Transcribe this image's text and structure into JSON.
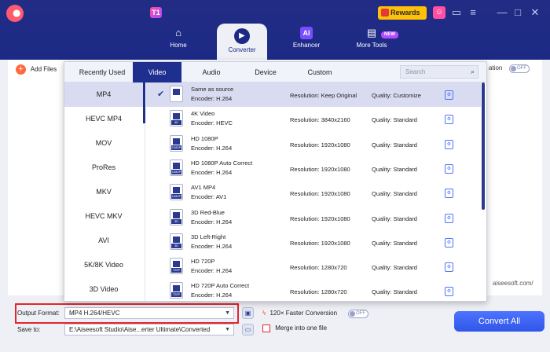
{
  "colors": {
    "topbar": "#1c2a86",
    "accent": "#1f2f8f",
    "highlight": "#d9dcf1",
    "convert_button": "#3f63f3",
    "red_box": "#e3262d",
    "rewards": "#ffc107"
  },
  "header": {
    "badge": "T1",
    "rewards_label": "Rewards",
    "nav": [
      {
        "label": "Home",
        "icon": "home-icon"
      },
      {
        "label": "Converter",
        "icon": "converter-icon"
      },
      {
        "label": "Enhancer",
        "icon": "ai-icon"
      },
      {
        "label": "More Tools",
        "icon": "toolbox-icon"
      }
    ],
    "new_tag": "NEW",
    "ai_tag": "AI"
  },
  "main": {
    "add_files": "Add Files",
    "merge_tail": "ation",
    "toggle_off": "OFF",
    "url_tail": "aiseesoft.com/"
  },
  "popup": {
    "tabs": [
      "Recently Used",
      "Video",
      "Audio",
      "Device",
      "Custom"
    ],
    "active_tab": "Video",
    "search_placeholder": "Search",
    "categories": [
      "MP4",
      "HEVC MP4",
      "MOV",
      "ProRes",
      "MKV",
      "HEVC MKV",
      "AVI",
      "5K/8K Video",
      "3D Video"
    ],
    "active_category": "MP4",
    "formats": [
      {
        "name": "Same as source",
        "encoder": "Encoder: H.264",
        "resolution": "Resolution: Keep Original",
        "quality": "Quality: Customize",
        "tag": ""
      },
      {
        "name": "4K Video",
        "encoder": "Encoder: HEVC",
        "resolution": "Resolution:  3840x2160",
        "quality": "Quality: Standard",
        "tag": "4K"
      },
      {
        "name": "HD 1080P",
        "encoder": "Encoder: H.264",
        "resolution": "Resolution:  1920x1080",
        "quality": "Quality: Standard",
        "tag": "1080P"
      },
      {
        "name": "HD 1080P Auto Correct",
        "encoder": "Encoder: H.264",
        "resolution": "Resolution:  1920x1080",
        "quality": "Quality: Standard",
        "tag": "1080P"
      },
      {
        "name": "AV1 MP4",
        "encoder": "Encoder: AV1",
        "resolution": "Resolution:  1920x1080",
        "quality": "Quality: Standard",
        "tag": "1080P"
      },
      {
        "name": "3D Red-Blue",
        "encoder": "Encoder: H.264",
        "resolution": "Resolution:  1920x1080",
        "quality": "Quality: Standard",
        "tag": "3D"
      },
      {
        "name": "3D Left-Right",
        "encoder": "Encoder: H.264",
        "resolution": "Resolution:  1920x1080",
        "quality": "Quality: Standard",
        "tag": "3D"
      },
      {
        "name": "HD 720P",
        "encoder": "Encoder: H.264",
        "resolution": "Resolution:  1280x720",
        "quality": "Quality: Standard",
        "tag": "720P"
      },
      {
        "name": "HD 720P Auto Correct",
        "encoder": "Encoder: H.264",
        "resolution": "Resolution:  1280x720",
        "quality": "Quality: Standard",
        "tag": "720P"
      }
    ]
  },
  "bottom": {
    "output_format_label": "Output Format:",
    "output_format_value": "MP4 H.264/HEVC",
    "save_to_label": "Save to:",
    "save_to_value": "E:\\Aiseesoft Studio\\Aise...erter Ultimate\\Converted",
    "accel_label": "120× Faster Conversion",
    "accel_toggle": "OFF",
    "merge_label": "Merge into one file",
    "convert_all": "Convert All"
  }
}
